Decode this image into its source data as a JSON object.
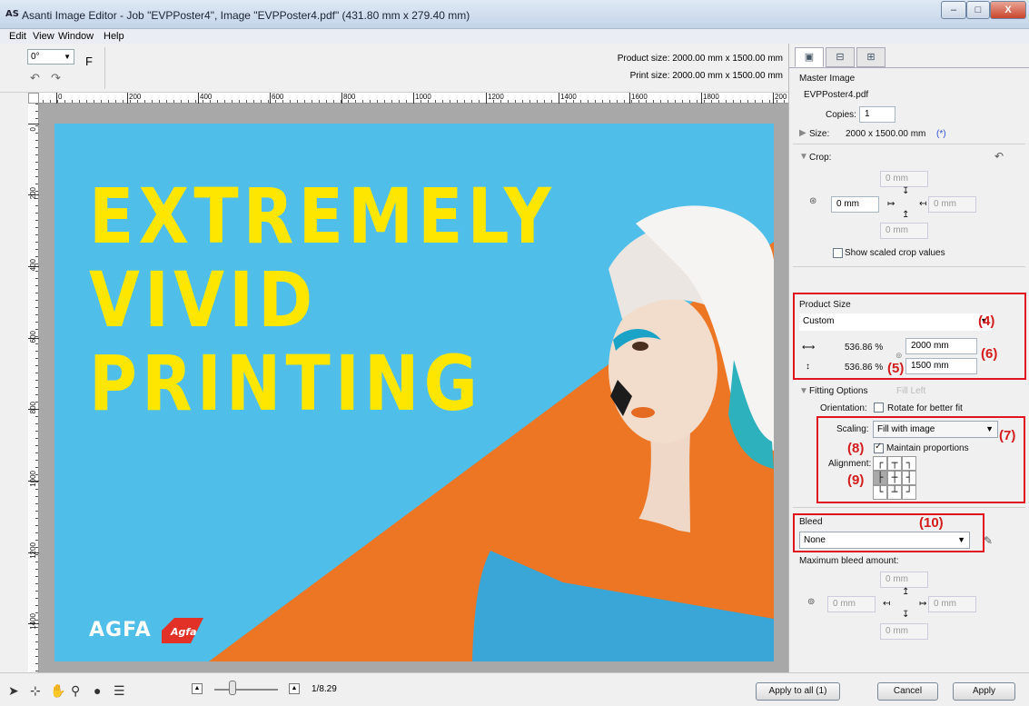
{
  "window": {
    "app_icon": "AS",
    "title": "Asanti Image Editor - Job \"EVPPoster4\", Image \"EVPPoster4.pdf\" (431.80 mm x 279.40 mm)",
    "minimize": "–",
    "maximize": "□",
    "close": "X"
  },
  "menu": [
    "Edit",
    "View",
    "Window",
    "Help"
  ],
  "toolbar": {
    "rotation_value": "0°",
    "f_label": "F",
    "product_size": "Product size: 2000.00 mm x 1500.00 mm",
    "print_size": "Print size: 2000.00 mm x 1500.00 mm"
  },
  "ruler": {
    "h_labels": [
      "0",
      "200",
      "400",
      "600",
      "800",
      "1000",
      "1200",
      "1400",
      "1600",
      "1800",
      "200"
    ],
    "v_labels": [
      "0",
      "200",
      "400",
      "600",
      "800",
      "1000",
      "1200",
      "1400"
    ]
  },
  "poster": {
    "line1": "EXTREMELY",
    "line2": "VIVID",
    "line3": "PRINTING",
    "brand": "AGFA",
    "logo_text": "Agfa",
    "colors": {
      "background": "#4fbee8",
      "headline": "#ffe600",
      "orange": "#ec7623",
      "sweater_blue": "#3aa6d8"
    }
  },
  "bottom": {
    "zoom_value": "1/8.29",
    "apply_all": "Apply to all (1)",
    "cancel": "Cancel",
    "apply": "Apply"
  },
  "panel": {
    "section_title": "Master Image",
    "filename": "EVPPoster4.pdf",
    "copies_label": "Copies:",
    "copies_value": "1",
    "size_label": "Size:",
    "size_value": "2000 x 1500.00 mm",
    "size_marker": "(*)",
    "crop_label": "Crop:",
    "crop_top": "0 mm",
    "crop_left": "0 mm",
    "crop_right": "0 mm",
    "crop_bottom": "0 mm",
    "show_scaled": "Show scaled crop values",
    "product_size_title": "Product Size",
    "product_size_value": "Custom",
    "scale_h": "536.86 %",
    "scale_v": "536.86 %",
    "width_value": "2000 mm",
    "height_value": "1500 mm",
    "fitting_options": "Fitting Options",
    "fill_left": "Fill Left",
    "orientation_label": "Orientation:",
    "rotate_label": "Rotate for better fit",
    "scaling_label": "Scaling:",
    "scaling_value": "Fill with image",
    "maintain_label": "Maintain proportions",
    "alignment_label": "Alignment:",
    "alignment_glyphs": [
      "┌",
      "┬",
      "┐",
      "├",
      "┼",
      "┤",
      "└",
      "┴",
      "┘"
    ],
    "bleed_title": "Bleed",
    "bleed_value": "None",
    "max_bleed_label": "Maximum bleed amount:",
    "bleed_top": "0 mm",
    "bleed_left": "0 mm",
    "bleed_right": "0 mm",
    "bleed_bottom": "0 mm"
  },
  "annotations": {
    "a4": "(4)",
    "a5": "(5)",
    "a6": "(6)",
    "a7": "(7)",
    "a8": "(8)",
    "a9": "(9)",
    "a10": "(10)",
    "color": "#e0141e"
  }
}
